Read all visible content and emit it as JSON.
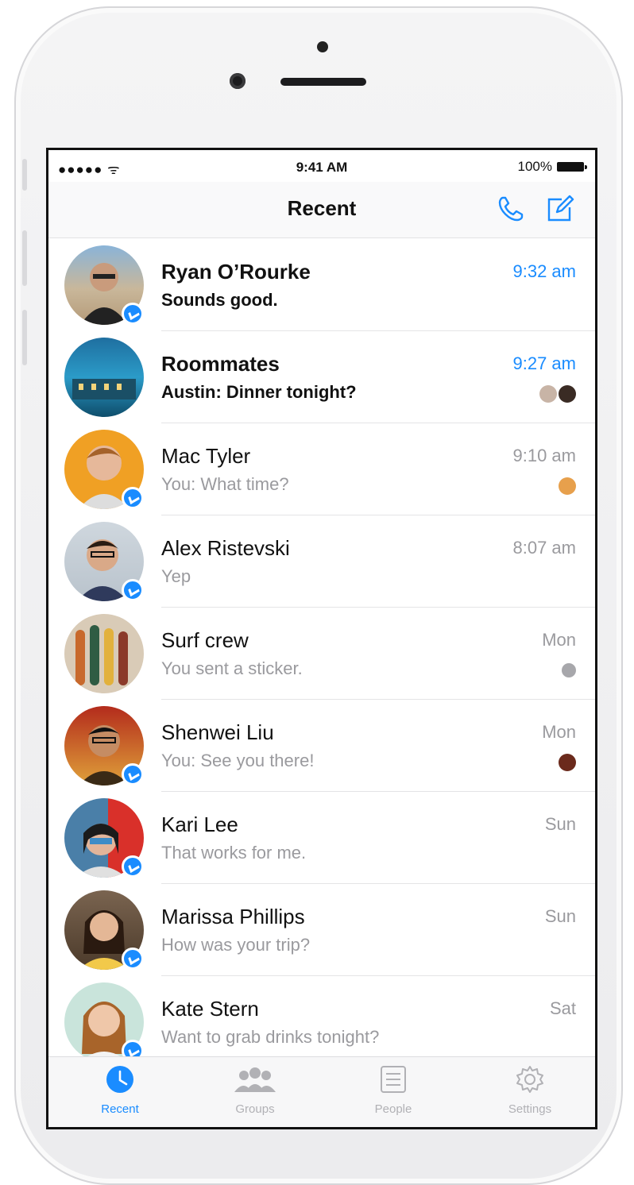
{
  "status": {
    "carrier_signal": "●●●●● ",
    "time": "9:41 AM",
    "battery": "100%"
  },
  "nav": {
    "title": "Recent"
  },
  "conversations": [
    {
      "name": "Ryan O’Rourke",
      "message": "Sounds good.",
      "time": "9:32 am",
      "unread": true
    },
    {
      "name": "Roommates",
      "message": "Austin: Dinner tonight?",
      "time": "9:27 am",
      "unread": true
    },
    {
      "name": "Mac Tyler",
      "message": "You: What time?",
      "time": "9:10 am",
      "unread": false
    },
    {
      "name": "Alex Ristevski",
      "message": "Yep",
      "time": "8:07 am",
      "unread": false
    },
    {
      "name": "Surf crew",
      "message": "You sent a sticker.",
      "time": "Mon",
      "unread": false
    },
    {
      "name": "Shenwei Liu",
      "message": "You: See you there!",
      "time": "Mon",
      "unread": false
    },
    {
      "name": "Kari Lee",
      "message": "That works for me.",
      "time": "Sun",
      "unread": false
    },
    {
      "name": "Marissa Phillips",
      "message": "How was your trip?",
      "time": "Sun",
      "unread": false
    },
    {
      "name": "Kate Stern",
      "message": "Want to grab drinks tonight?",
      "time": "Sat",
      "unread": false
    }
  ],
  "tabs": [
    {
      "label": "Recent",
      "active": true
    },
    {
      "label": "Groups",
      "active": false
    },
    {
      "label": "People",
      "active": false
    },
    {
      "label": "Settings",
      "active": false
    }
  ],
  "colors": {
    "accent": "#1a8cff",
    "secondary_text": "#9a9a9e"
  }
}
